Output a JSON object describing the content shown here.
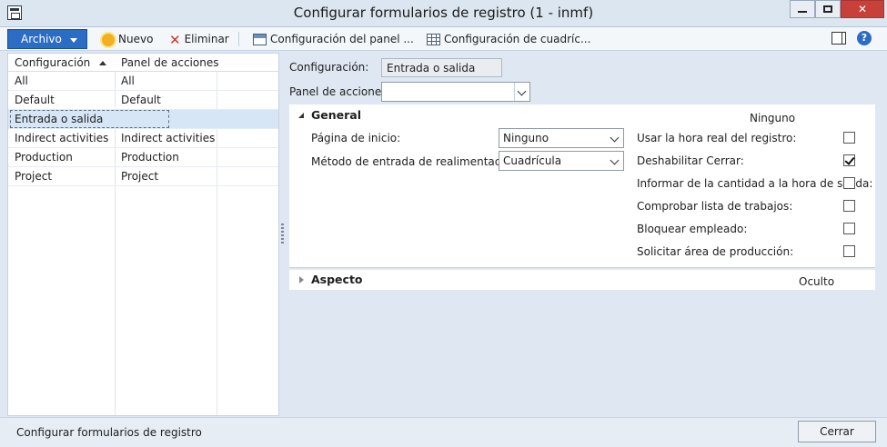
{
  "window": {
    "title": "Configurar formularios de registro (1 - inmf)"
  },
  "toolbar": {
    "archivo": "Archivo",
    "nuevo": "Nuevo",
    "eliminar": "Eliminar",
    "config_panel": "Configuración del panel ...",
    "config_cuadric": "Configuración de cuadríc..."
  },
  "grid": {
    "columns": [
      "Configuración",
      "Panel de acciones"
    ],
    "rows": [
      [
        "All",
        "All"
      ],
      [
        "Default",
        "Default"
      ],
      [
        "Entrada o salida",
        ""
      ],
      [
        "Indirect activities",
        "Indirect activities"
      ],
      [
        "Production",
        "Production"
      ],
      [
        "Project",
        "Project"
      ]
    ],
    "selected_row": 2
  },
  "form": {
    "config_label": "Configuración:",
    "config_value": "Entrada o salida",
    "panel_label": "Panel de acciones:",
    "panel_value": ""
  },
  "general": {
    "title": "General",
    "summary": "Ninguno",
    "pagina_label": "Página de inicio:",
    "pagina_value": "Ninguno",
    "metodo_label": "Método de entrada de realimentación:",
    "metodo_value": "Cuadrícula",
    "options": [
      {
        "label": "Usar la hora real del registro:",
        "checked": false
      },
      {
        "label": "Deshabilitar Cerrar:",
        "checked": true
      },
      {
        "label": "Informar de la cantidad a la hora de salida:",
        "checked": false
      },
      {
        "label": "Comprobar lista de trabajos:",
        "checked": false
      },
      {
        "label": "Bloquear empleado:",
        "checked": false
      },
      {
        "label": "Solicitar área de producción:",
        "checked": false
      }
    ]
  },
  "aspecto": {
    "title": "Aspecto",
    "summary": "Oculto"
  },
  "status": {
    "text": "Configurar formularios de registro",
    "close": "Cerrar"
  }
}
